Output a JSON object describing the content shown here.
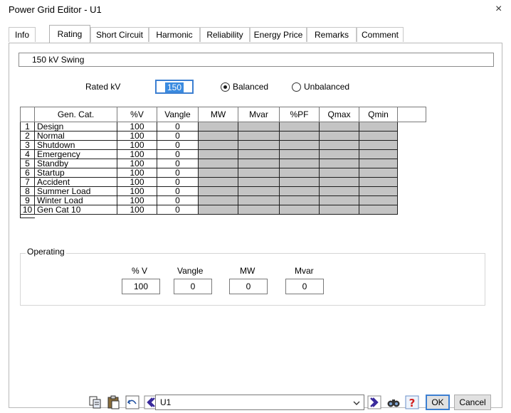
{
  "window": {
    "title": "Power Grid Editor - U1",
    "close_glyph": "×"
  },
  "tabs": [
    "Info",
    "Rating",
    "Short Circuit",
    "Harmonic",
    "Reliability",
    "Energy Price",
    "Remarks",
    "Comment"
  ],
  "active_tab": "Rating",
  "description": "150 kV  Swing",
  "rating": {
    "rated_kv_label": "Rated kV",
    "rated_kv_value": "150",
    "balanced_label": "Balanced",
    "unbalanced_label": "Unbalanced",
    "selected": "Balanced"
  },
  "grid": {
    "headers": [
      "Gen. Cat.",
      "%V",
      "Vangle",
      "MW",
      "Mvar",
      "%PF",
      "Qmax",
      "Qmin"
    ],
    "rows": [
      {
        "num": "1",
        "cat": "Design",
        "pv": "100",
        "vangle": "0"
      },
      {
        "num": "2",
        "cat": "Normal",
        "pv": "100",
        "vangle": "0"
      },
      {
        "num": "3",
        "cat": "Shutdown",
        "pv": "100",
        "vangle": "0"
      },
      {
        "num": "4",
        "cat": "Emergency",
        "pv": "100",
        "vangle": "0"
      },
      {
        "num": "5",
        "cat": "Standby",
        "pv": "100",
        "vangle": "0"
      },
      {
        "num": "6",
        "cat": "Startup",
        "pv": "100",
        "vangle": "0"
      },
      {
        "num": "7",
        "cat": "Accident",
        "pv": "100",
        "vangle": "0"
      },
      {
        "num": "8",
        "cat": "Summer Load",
        "pv": "100",
        "vangle": "0"
      },
      {
        "num": "9",
        "cat": "Winter Load",
        "pv": "100",
        "vangle": "0"
      },
      {
        "num": "10",
        "cat": "Gen Cat 10",
        "pv": "100",
        "vangle": "0"
      }
    ]
  },
  "operating": {
    "label": "Operating",
    "v_label": "% V",
    "v_value": "100",
    "vangle_label": "Vangle",
    "vangle_value": "0",
    "mw_label": "MW",
    "mw_value": "0",
    "mvar_label": "Mvar",
    "mvar_value": "0"
  },
  "toolbar": {
    "combo_value": "U1",
    "ok_label": "OK",
    "cancel_label": "Cancel",
    "icons": [
      "copy-icon",
      "paste-icon",
      "undo-icon",
      "previous-icon",
      "next-icon",
      "find-icon",
      "help-icon"
    ]
  },
  "colors": {
    "shade": "#c4c4c4",
    "accent": "#3b8be0",
    "help": "#d21f1f"
  }
}
